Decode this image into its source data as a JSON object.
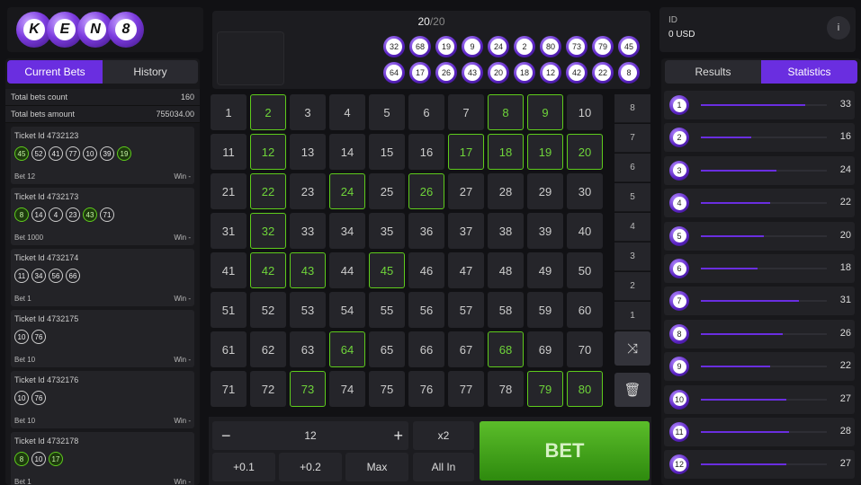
{
  "logo": {
    "letters": [
      "K",
      "E",
      "N",
      "8"
    ]
  },
  "left": {
    "tabs": [
      "Current Bets",
      "History"
    ],
    "totals": [
      {
        "label": "Total bets count",
        "value": "160"
      },
      {
        "label": "Total bets amount",
        "value": "755034.00"
      }
    ],
    "tickets": [
      {
        "id": "Ticket Id 4732123",
        "bet": "Bet 12",
        "win": "Win -",
        "nums": [
          {
            "n": "45",
            "hit": true
          },
          {
            "n": "52",
            "hit": false
          },
          {
            "n": "41",
            "hit": false
          },
          {
            "n": "77",
            "hit": false
          },
          {
            "n": "10",
            "hit": false
          },
          {
            "n": "39",
            "hit": false
          },
          {
            "n": "19",
            "hit": true
          }
        ]
      },
      {
        "id": "Ticket Id 4732173",
        "bet": "Bet 1000",
        "win": "Win -",
        "nums": [
          {
            "n": "8",
            "hit": true
          },
          {
            "n": "14",
            "hit": false
          },
          {
            "n": "4",
            "hit": false
          },
          {
            "n": "23",
            "hit": false
          },
          {
            "n": "43",
            "hit": true
          },
          {
            "n": "71",
            "hit": false
          }
        ]
      },
      {
        "id": "Ticket Id 4732174",
        "bet": "Bet 1",
        "win": "Win -",
        "nums": [
          {
            "n": "11",
            "hit": false
          },
          {
            "n": "34",
            "hit": false
          },
          {
            "n": "56",
            "hit": false
          },
          {
            "n": "66",
            "hit": false
          }
        ]
      },
      {
        "id": "Ticket Id 4732175",
        "bet": "Bet 10",
        "win": "Win -",
        "nums": [
          {
            "n": "10",
            "hit": false
          },
          {
            "n": "76",
            "hit": false
          }
        ]
      },
      {
        "id": "Ticket Id 4732176",
        "bet": "Bet 10",
        "win": "Win -",
        "nums": [
          {
            "n": "10",
            "hit": false
          },
          {
            "n": "76",
            "hit": false
          }
        ]
      },
      {
        "id": "Ticket Id 4732178",
        "bet": "Bet 1",
        "win": "Win -",
        "nums": [
          {
            "n": "8",
            "hit": true
          },
          {
            "n": "10",
            "hit": false
          },
          {
            "n": "17",
            "hit": true
          }
        ]
      }
    ]
  },
  "draw": {
    "count": "20",
    "total": "/20",
    "row1": [
      "32",
      "68",
      "19",
      "9",
      "24",
      "2",
      "80",
      "73",
      "79",
      "45"
    ],
    "row2": [
      "64",
      "17",
      "26",
      "43",
      "20",
      "18",
      "12",
      "42",
      "22",
      "8"
    ]
  },
  "grid": {
    "numbers": [
      "1",
      "2",
      "3",
      "4",
      "5",
      "6",
      "7",
      "8",
      "9",
      "10",
      "11",
      "12",
      "13",
      "14",
      "15",
      "16",
      "17",
      "18",
      "19",
      "20",
      "21",
      "22",
      "23",
      "24",
      "25",
      "26",
      "27",
      "28",
      "29",
      "30",
      "31",
      "32",
      "33",
      "34",
      "35",
      "36",
      "37",
      "38",
      "39",
      "40",
      "41",
      "42",
      "43",
      "44",
      "45",
      "46",
      "47",
      "48",
      "49",
      "50",
      "51",
      "52",
      "53",
      "54",
      "55",
      "56",
      "57",
      "58",
      "59",
      "60",
      "61",
      "62",
      "63",
      "64",
      "65",
      "66",
      "67",
      "68",
      "69",
      "70",
      "71",
      "72",
      "73",
      "74",
      "75",
      "76",
      "77",
      "78",
      "79",
      "80"
    ],
    "drawn": [
      2,
      8,
      9,
      12,
      17,
      18,
      19,
      20,
      22,
      24,
      26,
      32,
      42,
      43,
      45,
      64,
      68,
      73,
      79,
      80
    ]
  },
  "payout": {
    "labels": [
      "8",
      "7",
      "6",
      "5",
      "4",
      "3",
      "2",
      "1"
    ],
    "shuffle_icon": "shuffle-icon",
    "clear_icon": "trash-icon"
  },
  "bet": {
    "minus": "−",
    "amount": "12",
    "plus": "+",
    "double": "x2",
    "quick": [
      "+0.1",
      "+0.2",
      "Max",
      "All In"
    ],
    "bet_label": "BET"
  },
  "account": {
    "id_label": "ID",
    "balance": "0 USD",
    "info": "i"
  },
  "right": {
    "tabs": [
      "Results",
      "Statistics"
    ],
    "stats": [
      {
        "n": "1",
        "v": "33"
      },
      {
        "n": "2",
        "v": "16"
      },
      {
        "n": "3",
        "v": "24"
      },
      {
        "n": "4",
        "v": "22"
      },
      {
        "n": "5",
        "v": "20"
      },
      {
        "n": "6",
        "v": "18"
      },
      {
        "n": "7",
        "v": "31"
      },
      {
        "n": "8",
        "v": "26"
      },
      {
        "n": "9",
        "v": "22"
      },
      {
        "n": "10",
        "v": "27"
      },
      {
        "n": "11",
        "v": "28"
      },
      {
        "n": "12",
        "v": "27"
      }
    ],
    "max": 40,
    "colors": {
      "accent": "#6a2ee0",
      "hit": "#5ecb1c"
    }
  }
}
